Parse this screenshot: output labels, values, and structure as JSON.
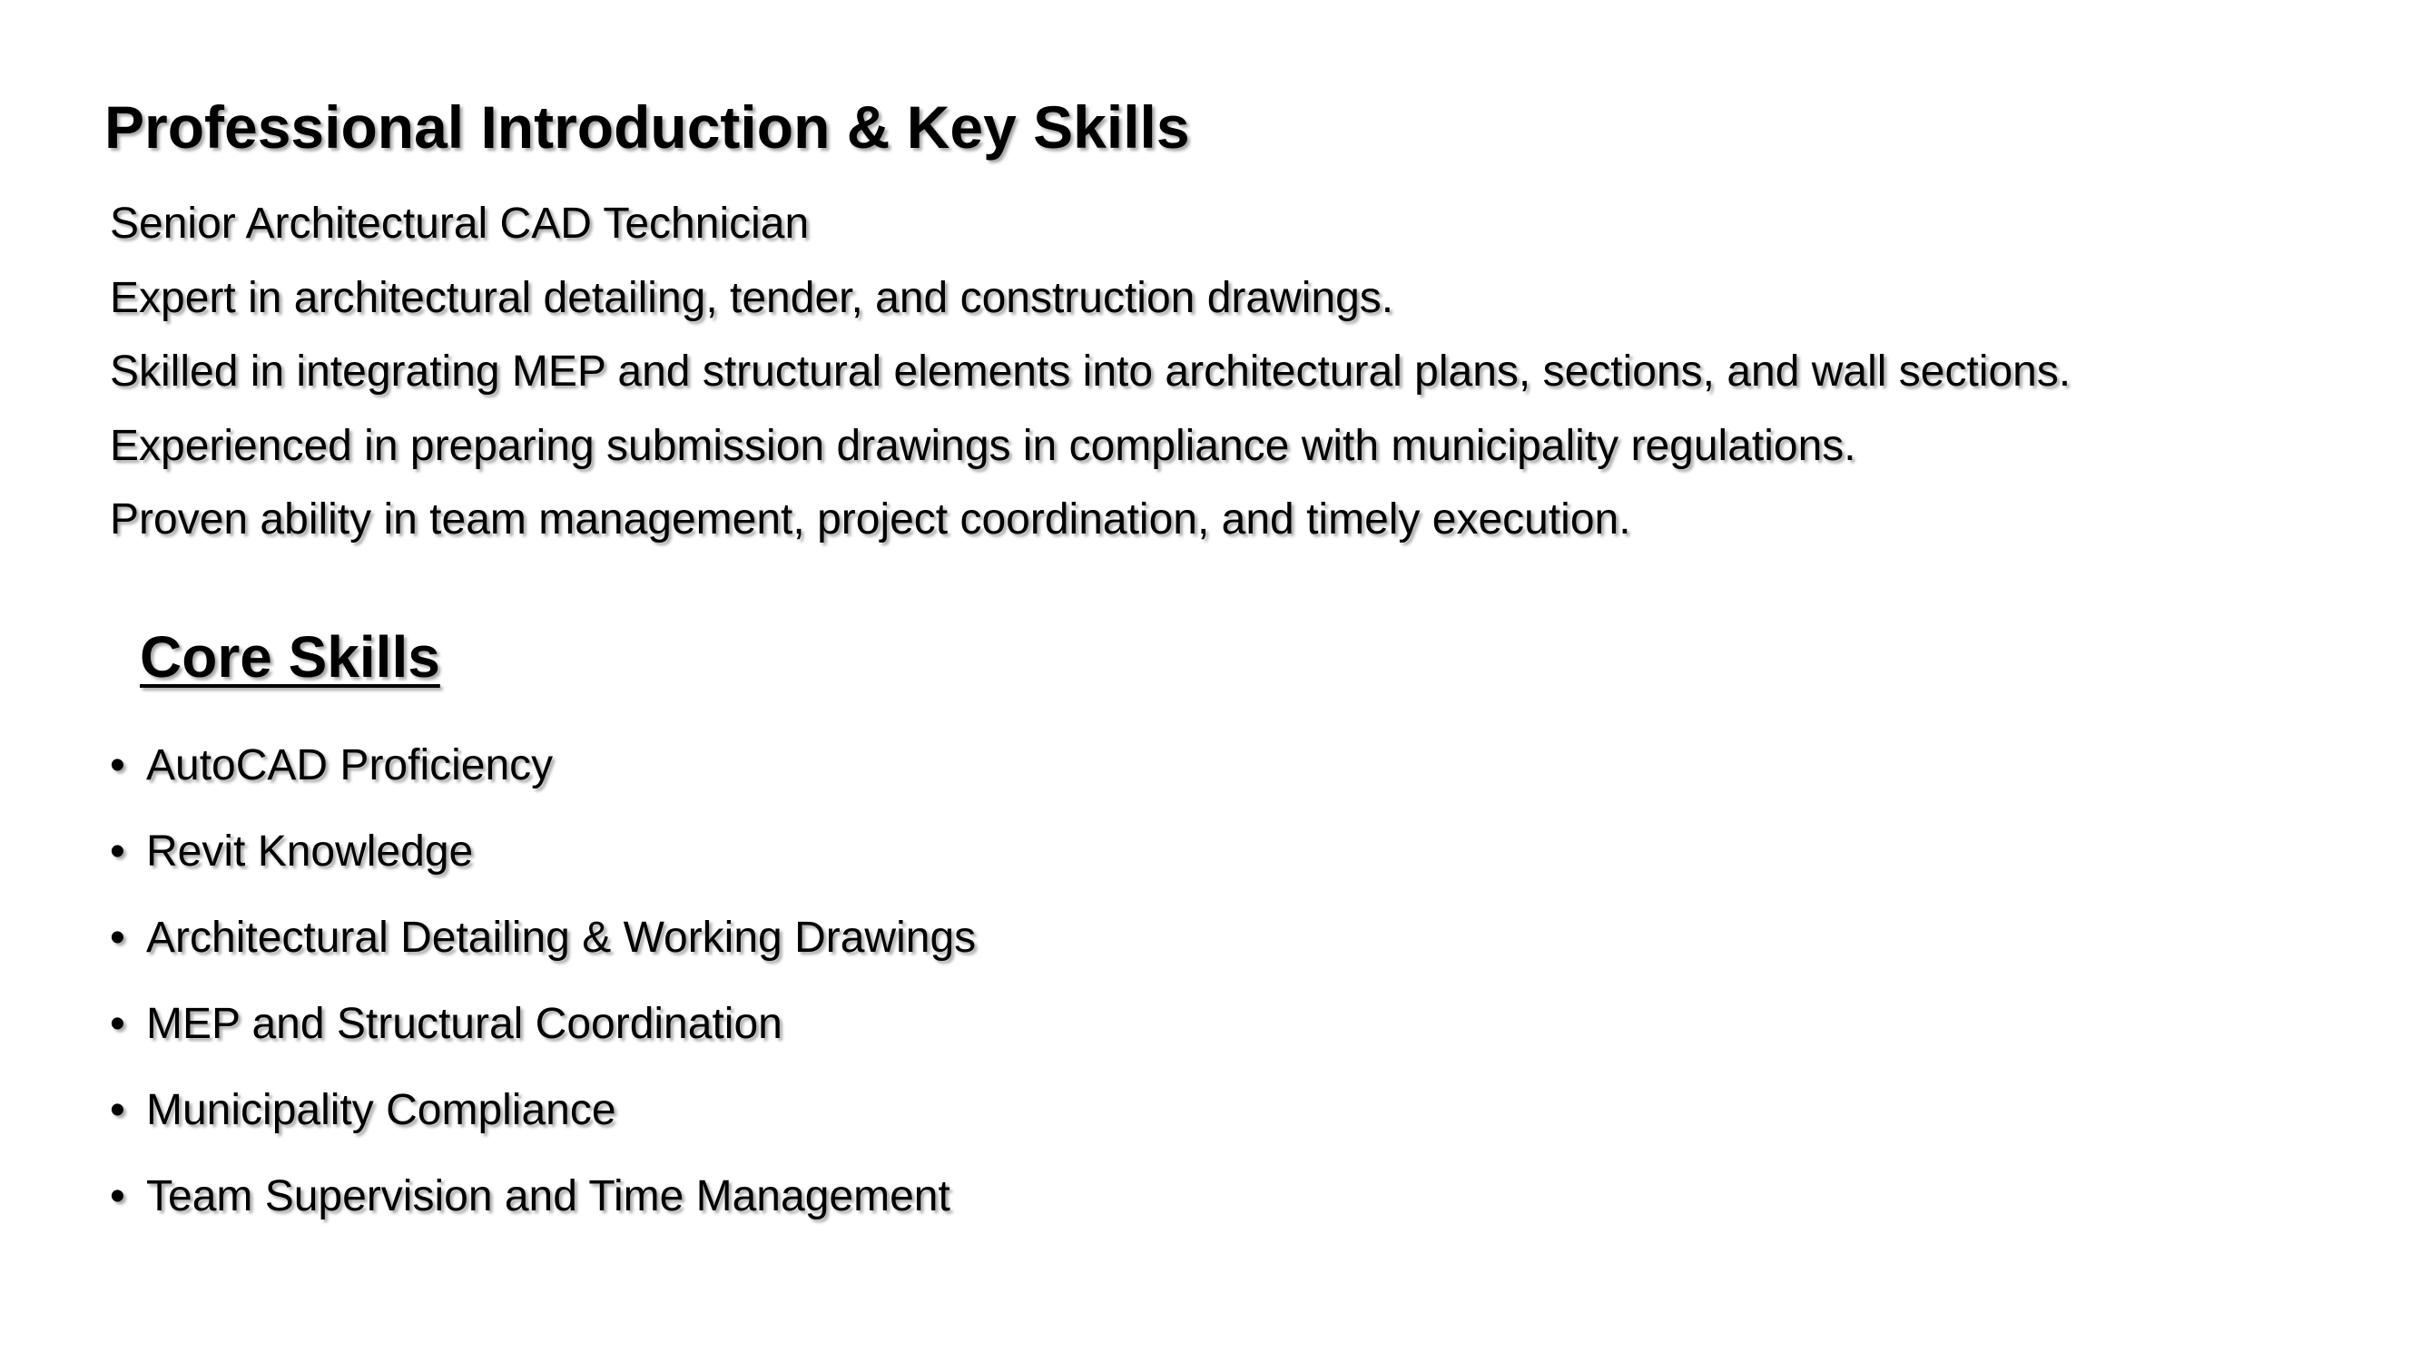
{
  "slide": {
    "title": "Professional Introduction & Key Skills",
    "intro_lines": [
      "Senior Architectural CAD Technician",
      "Expert in architectural detailing, tender, and construction drawings.",
      "Skilled in integrating MEP and structural elements into architectural plans, sections, and wall sections.",
      "Experienced in preparing submission drawings in compliance with municipality regulations.",
      "Proven ability in team management, project coordination, and timely execution."
    ],
    "core_skills_heading": "Core Skills",
    "bullet_glyph": "•",
    "core_skills": [
      "AutoCAD Proficiency",
      "Revit Knowledge",
      "Architectural Detailing & Working Drawings",
      "MEP and Structural Coordination",
      "Municipality Compliance",
      "Team Supervision and Time Management"
    ]
  },
  "colors": {
    "background": "#ffffff",
    "text": "#000000"
  }
}
